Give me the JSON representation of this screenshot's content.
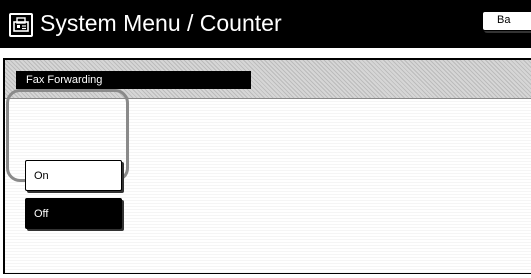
{
  "title_bar": {
    "title": "System Menu / Counter",
    "icon": "fax-machine-icon"
  },
  "header": {
    "label": "Fax Forwarding",
    "back_label": "Ba"
  },
  "options": [
    {
      "label": "On",
      "selected": false
    },
    {
      "label": "Off",
      "selected": true
    }
  ],
  "colors": {
    "titlebar": "#000000",
    "selected": "#000000",
    "outline": "#8a8a8a"
  }
}
